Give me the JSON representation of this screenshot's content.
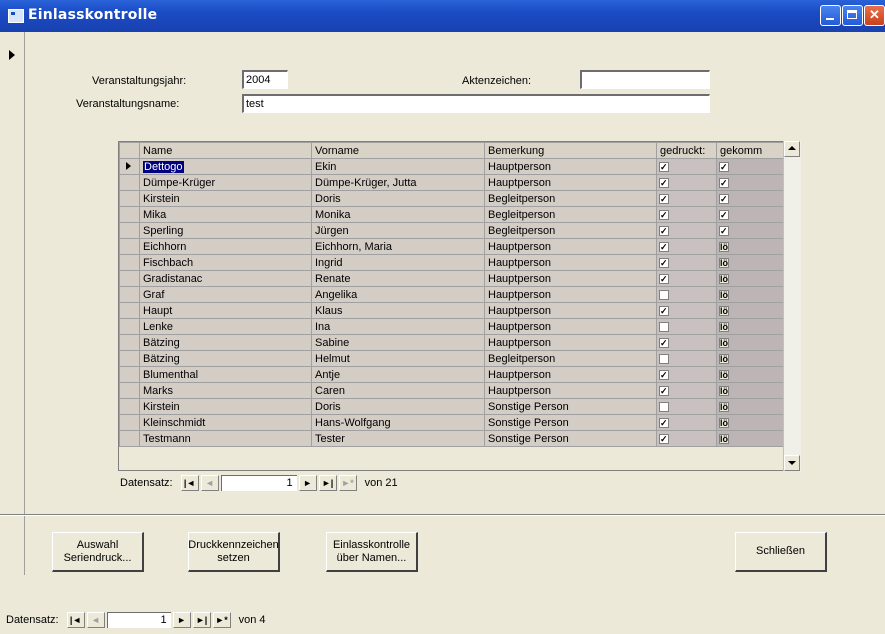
{
  "window": {
    "title": "Einlasskontrolle"
  },
  "form": {
    "year_label": "Veranstaltungsjahr:",
    "year_value": "2004",
    "aktenzeichen_label": "Aktenzeichen:",
    "aktenzeichen_value": "",
    "name_label": "Veranstaltungsname:",
    "name_value": "test"
  },
  "grid": {
    "columns": [
      "Name",
      "Vorname",
      "Bemerkung",
      "gedruckt:",
      "gekomm"
    ],
    "rows": [
      {
        "name": "Dettogo",
        "vorname": "Ekin",
        "bemerkung": "Hauptperson",
        "gedruckt": true,
        "gekommen": "checked"
      },
      {
        "name": "Dümpe-Krüger",
        "vorname": "Dümpe-Krüger, Jutta",
        "bemerkung": "Hauptperson",
        "gedruckt": true,
        "gekommen": "checked"
      },
      {
        "name": "Kirstein",
        "vorname": "Doris",
        "bemerkung": "Begleitperson",
        "gedruckt": true,
        "gekommen": "checked"
      },
      {
        "name": "Mika",
        "vorname": "Monika",
        "bemerkung": "Begleitperson",
        "gedruckt": true,
        "gekommen": "checked"
      },
      {
        "name": "Sperling",
        "vorname": "Jürgen",
        "bemerkung": "Begleitperson",
        "gedruckt": true,
        "gekommen": "checked"
      },
      {
        "name": "Eichhorn",
        "vorname": "Eichhorn, Maria",
        "bemerkung": "Hauptperson",
        "gedruckt": true,
        "gekommen": "null"
      },
      {
        "name": "Fischbach",
        "vorname": "Ingrid",
        "bemerkung": "Hauptperson",
        "gedruckt": true,
        "gekommen": "null"
      },
      {
        "name": "Gradistanac",
        "vorname": "Renate",
        "bemerkung": "Hauptperson",
        "gedruckt": true,
        "gekommen": "null"
      },
      {
        "name": "Graf",
        "vorname": "Angelika",
        "bemerkung": "Hauptperson",
        "gedruckt": false,
        "gekommen": "null"
      },
      {
        "name": "Haupt",
        "vorname": "Klaus",
        "bemerkung": "Hauptperson",
        "gedruckt": true,
        "gekommen": "null"
      },
      {
        "name": "Lenke",
        "vorname": "Ina",
        "bemerkung": "Hauptperson",
        "gedruckt": false,
        "gekommen": "null"
      },
      {
        "name": "Bätzing",
        "vorname": "Sabine",
        "bemerkung": "Hauptperson",
        "gedruckt": true,
        "gekommen": "null"
      },
      {
        "name": "Bätzing",
        "vorname": "Helmut",
        "bemerkung": "Begleitperson",
        "gedruckt": false,
        "gekommen": "null"
      },
      {
        "name": "Blumenthal",
        "vorname": "Antje",
        "bemerkung": "Hauptperson",
        "gedruckt": true,
        "gekommen": "null"
      },
      {
        "name": "Marks",
        "vorname": "Caren",
        "bemerkung": "Hauptperson",
        "gedruckt": true,
        "gekommen": "null"
      },
      {
        "name": "Kirstein",
        "vorname": "Doris",
        "bemerkung": "Sonstige Person",
        "gedruckt": false,
        "gekommen": "null"
      },
      {
        "name": "Kleinschmidt",
        "vorname": "Hans-Wolfgang",
        "bemerkung": "Sonstige Person",
        "gedruckt": true,
        "gekommen": "null"
      },
      {
        "name": "Testmann",
        "vorname": "Tester",
        "bemerkung": "Sonstige Person",
        "gedruckt": true,
        "gekommen": "null"
      }
    ],
    "null_glyph": "lö"
  },
  "subnav": {
    "label": "Datensatz:",
    "current": "1",
    "of_text": "von 21"
  },
  "buttons": {
    "auswahl": "Auswahl\nSeriendruck...",
    "druck": "Druckkennzeichen\nsetzen",
    "einlass": "Einlasskontrolle\nüber Namen...",
    "schliessen": "Schließen"
  },
  "mainnav": {
    "label": "Datensatz:",
    "current": "1",
    "of_text": "von 4"
  }
}
